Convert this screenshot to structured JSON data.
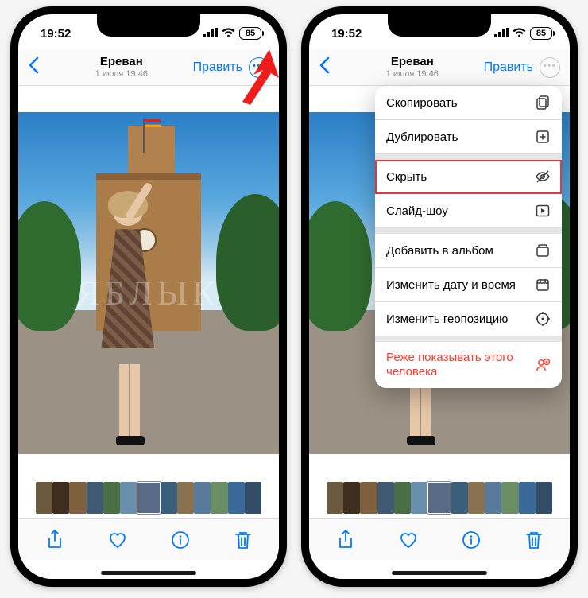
{
  "status": {
    "time": "19:52",
    "battery": "85"
  },
  "nav": {
    "title": "Ереван",
    "subtitle": "1 июля 19:46",
    "edit": "Править"
  },
  "watermark": "ЯБЛЫК",
  "menu": {
    "copy": "Скопировать",
    "duplicate": "Дублировать",
    "hide": "Скрыть",
    "slideshow": "Слайд-шоу",
    "add_album": "Добавить в альбом",
    "change_date": "Изменить дату и время",
    "change_location": "Изменить геопозицию",
    "feature_less": "Реже показывать этого человека"
  },
  "thumb_colors": [
    "#6b5a3e",
    "#3d2e20",
    "#7e603f",
    "#405a73",
    "#4a6e45",
    "#6a8fae",
    "#586a86",
    "#3a5f7a",
    "#8a7250",
    "#5a7a9c",
    "#6b8d63",
    "#3a6a9a",
    "#334d66"
  ]
}
